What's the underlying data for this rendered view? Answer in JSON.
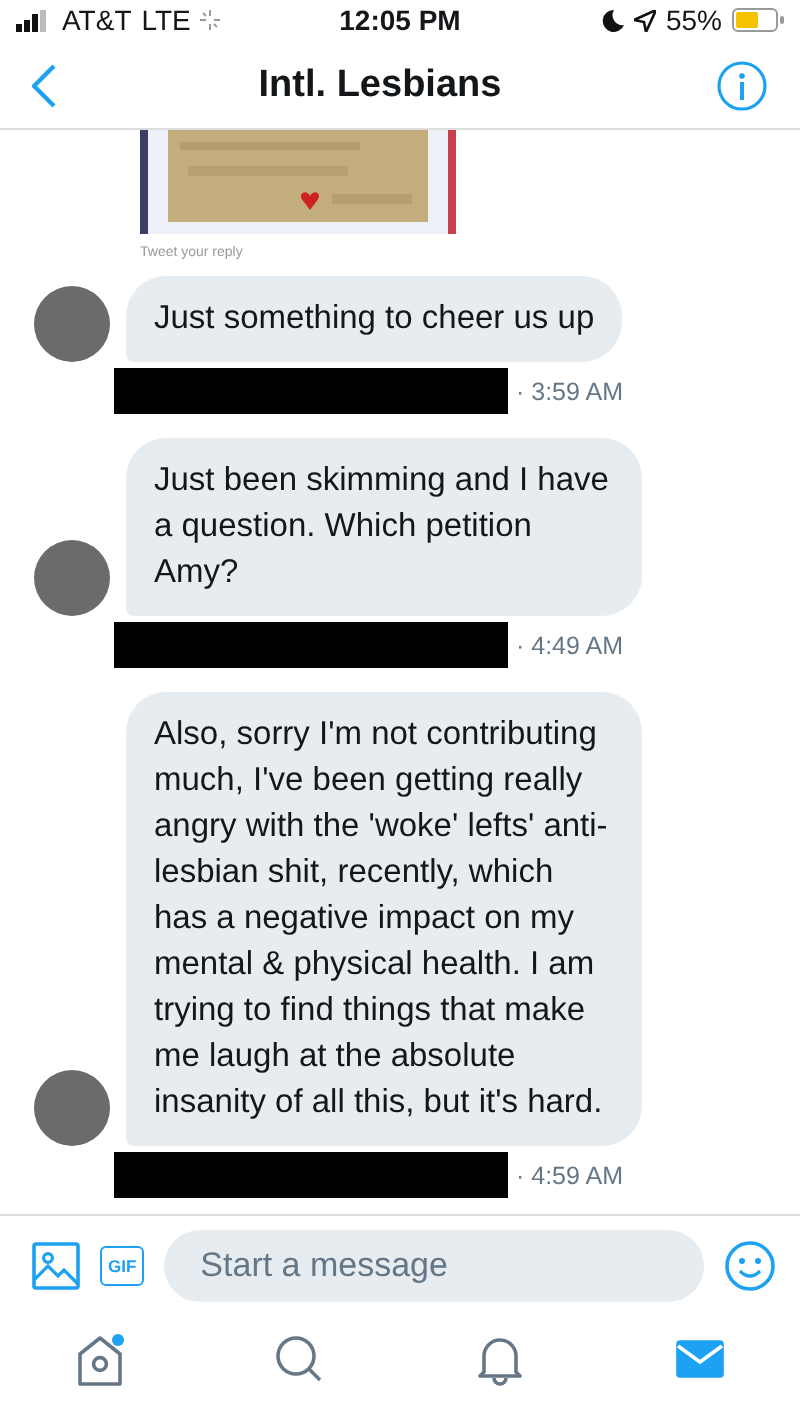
{
  "status_bar": {
    "carrier": "AT&T",
    "network": "LTE",
    "time": "12:05 PM",
    "battery": "55%"
  },
  "header": {
    "title": "Intl. Lesbians"
  },
  "shared_tweet": {
    "kind": "picture",
    "caption": "Tweet your reply"
  },
  "messages": [
    {
      "text": "Just something to cheer us up",
      "time": "· 3:59 AM",
      "redacted": true
    },
    {
      "text": "Just been skimming and I have a question. Which petition Amy?",
      "time": "· 4:49 AM",
      "redacted": true
    },
    {
      "text": "Also, sorry I'm not contributing much, I've been getting really angry with the 'woke' lefts' anti-lesbian shit, recently, which has a negative impact on my mental & physical health. I am trying to find things that make me laugh at the absolute insanity of all this, but it's hard.",
      "time": "· 4:59 AM",
      "redacted": true
    }
  ],
  "composer": {
    "gif": "GIF",
    "placeholder": "Start a message"
  },
  "tab_bar": [
    {
      "kind": "home",
      "selected": false,
      "badge": true
    },
    {
      "kind": "search",
      "selected": false,
      "badge": false
    },
    {
      "kind": "notifications",
      "selected": false,
      "badge": false
    },
    {
      "kind": "messages",
      "selected": true,
      "badge": false
    }
  ]
}
